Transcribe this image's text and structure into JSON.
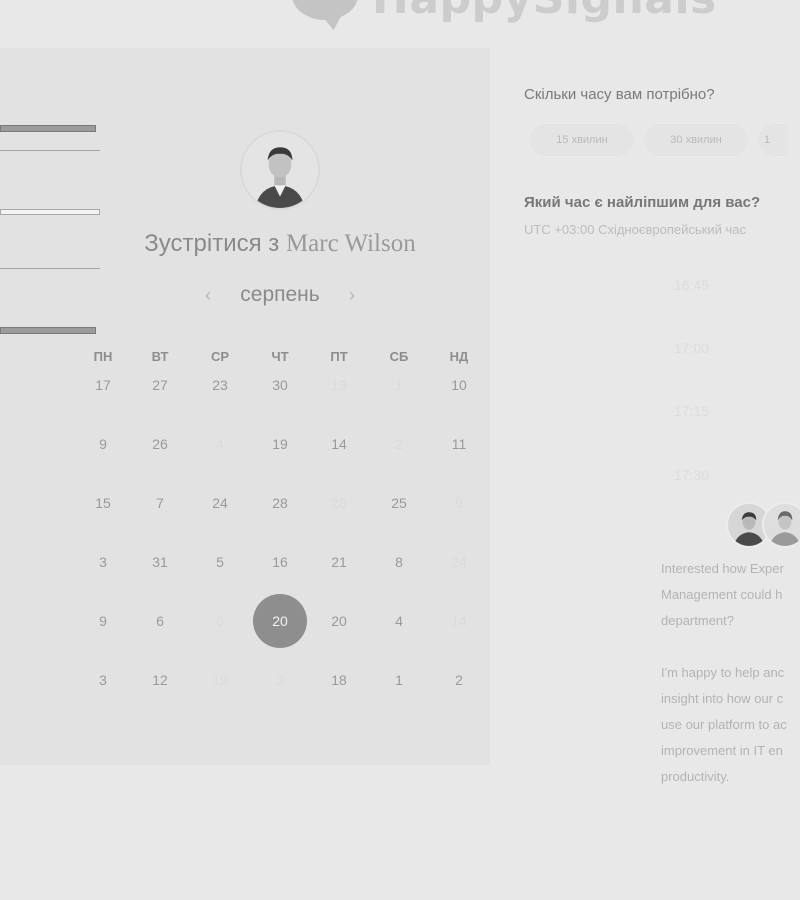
{
  "brand": {
    "name": "HappySignals"
  },
  "calendar": {
    "avatar": "avatar-marc-wilson",
    "title_prefix": "Зустрітися з",
    "title_name": "Marc Wilson",
    "month": "серпень",
    "prev_icon": "‹",
    "next_icon": "›",
    "weekdays": [
      "ПН",
      "ВТ",
      "СР",
      "ЧТ",
      "ПТ",
      "СБ",
      "НД"
    ],
    "rows": [
      [
        "17",
        "27",
        "23",
        "30",
        "13",
        "1",
        "10"
      ],
      [
        "9",
        "26",
        "4",
        "19",
        "14",
        "2",
        "11"
      ],
      [
        "15",
        "7",
        "24",
        "28",
        "28",
        "25",
        "9"
      ],
      [
        "3",
        "31",
        "5",
        "16",
        "21",
        "8",
        "24"
      ],
      [
        "9",
        "6",
        "6",
        "20",
        "20",
        "4",
        "14"
      ],
      [
        "3",
        "12",
        "19",
        "3",
        "18",
        "1",
        "2"
      ]
    ],
    "faint": [
      [
        0,
        4
      ],
      [
        0,
        5
      ],
      [
        1,
        2
      ],
      [
        1,
        5
      ],
      [
        2,
        4
      ],
      [
        2,
        6
      ],
      [
        3,
        6
      ],
      [
        4,
        2
      ],
      [
        4,
        6
      ],
      [
        5,
        2
      ],
      [
        5,
        3
      ]
    ],
    "selected": [
      4,
      3
    ]
  },
  "duration": {
    "question": "Скільки часу вам потрібно?",
    "options": [
      "15 хвилин",
      "30 хвилин",
      "1"
    ]
  },
  "time": {
    "question": "Який час є найліпшим для вас?",
    "timezone": "UTC +03:00 Східноєвропейський час",
    "slots": [
      "16:45",
      "17:00",
      "17:15",
      "17:30"
    ]
  },
  "message": {
    "lines": [
      "Interested how Exper",
      "Management could h",
      "department?",
      "",
      "I'm happy to help anc",
      "insight into how our c",
      "use our platform to ac",
      "improvement in IT en",
      "productivity."
    ]
  },
  "colors": {
    "background": "#e8e8e8",
    "panel": "#e2e2e2",
    "selected_day": "#8e8e8e"
  }
}
